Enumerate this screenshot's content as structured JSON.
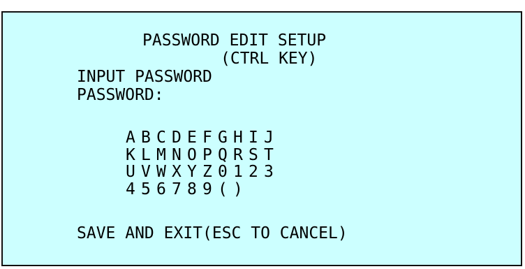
{
  "screen": {
    "title": "PASSWORD EDIT SETUP",
    "subtitle": "(CTRL KEY)",
    "prompt": "INPUT PASSWORD",
    "password_label": "PASSWORD:",
    "password_value": "",
    "keypad": [
      [
        "A",
        "B",
        "C",
        "D",
        "E",
        "F",
        "G",
        "H",
        "I",
        "J"
      ],
      [
        "K",
        "L",
        "M",
        "N",
        "O",
        "P",
        "Q",
        "R",
        "S",
        "T"
      ],
      [
        "U",
        "V",
        "W",
        "X",
        "Y",
        "Z",
        "0",
        "1",
        "2",
        "3"
      ],
      [
        "4",
        "5",
        "6",
        "7",
        "8",
        "9",
        "(",
        ")"
      ]
    ],
    "save_exit_label": "SAVE AND EXIT(ESC TO CANCEL)"
  },
  "colors": {
    "background": "#ccffff",
    "text": "#000000",
    "border": "#111111"
  }
}
